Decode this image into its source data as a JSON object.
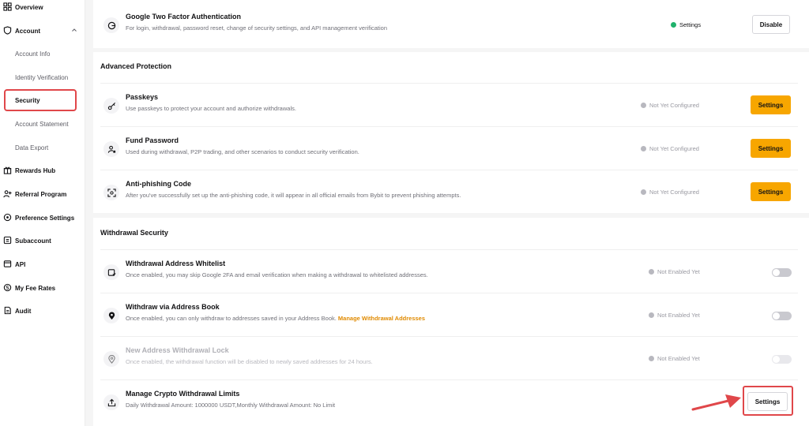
{
  "sidebar": {
    "items": [
      {
        "label": "Overview",
        "icon": "overview-icon"
      },
      {
        "label": "Account",
        "icon": "shield-account-icon"
      },
      {
        "label": "Rewards Hub",
        "icon": "gift-icon"
      },
      {
        "label": "Referral Program",
        "icon": "referral-icon"
      },
      {
        "label": "Preference Settings",
        "icon": "preference-icon"
      },
      {
        "label": "Subaccount",
        "icon": "subaccount-icon"
      },
      {
        "label": "API",
        "icon": "api-icon"
      },
      {
        "label": "My Fee Rates",
        "icon": "fee-icon"
      },
      {
        "label": "Audit",
        "icon": "audit-icon"
      }
    ],
    "account_sub": [
      "Account Info",
      "Identity Verification",
      "Security",
      "Account Statement",
      "Data Export"
    ]
  },
  "google2fa": {
    "title": "Google Two Factor Authentication",
    "desc": "For login, withdrawal, password reset, change of security settings, and API management verification",
    "status": "Settings",
    "button": "Disable"
  },
  "advanced": {
    "title": "Advanced Protection",
    "rows": [
      {
        "title": "Passkeys",
        "desc": "Use passkeys to protect your account and authorize withdrawals.",
        "status": "Not Yet Configured",
        "button": "Settings"
      },
      {
        "title": "Fund Password",
        "desc": "Used during withdrawal, P2P trading, and other scenarios to conduct security verification.",
        "status": "Not Yet Configured",
        "button": "Settings"
      },
      {
        "title": "Anti-phishing Code",
        "desc": "After you've successfully set up the anti-phishing code, it will appear in all official emails from Bybit to prevent phishing attempts.",
        "status": "Not Yet Configured",
        "button": "Settings"
      }
    ]
  },
  "withdrawal": {
    "title": "Withdrawal Security",
    "rows": [
      {
        "title": "Withdrawal Address Whitelist",
        "desc": "Once enabled, you may skip Google 2FA and email verification when making a withdrawal to whitelisted addresses.",
        "status": "Not Enabled Yet"
      },
      {
        "title": "Withdraw via Address Book",
        "desc": "Once enabled, you can only withdraw to addresses saved in your Address Book.",
        "link": "Manage Withdrawal Addresses",
        "status": "Not Enabled Yet"
      },
      {
        "title": "New Address Withdrawal Lock",
        "desc": "Once enabled, the withdrawal function will be disabled to newly saved addresses for 24 hours.",
        "status": "Not Enabled Yet"
      },
      {
        "title": "Manage Crypto Withdrawal Limits",
        "desc": "Daily Withdrawal Amount: 1000000 USDT,Monthly Withdrawal Amount: No Limit",
        "button": "Settings"
      }
    ]
  },
  "colors": {
    "accent": "#f7a600",
    "highlight": "#e0474a",
    "success": "#20b26c"
  }
}
